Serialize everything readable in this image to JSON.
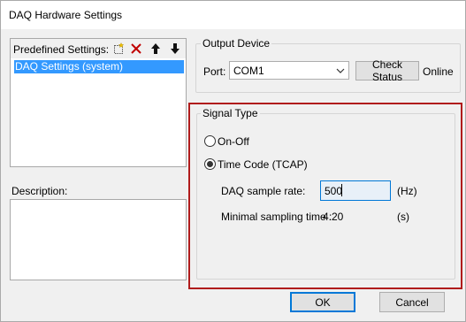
{
  "window": {
    "title": "DAQ Hardware Settings"
  },
  "predefined": {
    "label": "Predefined Settings:",
    "icons": [
      "new-icon",
      "delete-icon",
      "move-up-icon",
      "move-down-icon"
    ],
    "items": [
      "DAQ Settings (system)"
    ]
  },
  "description": {
    "label": "Description:",
    "value": ""
  },
  "output_device": {
    "title": "Output Device",
    "port_label": "Port:",
    "port_value": "COM1",
    "check_status_label": "Check Status",
    "status_text": "Online"
  },
  "signal_type": {
    "title": "Signal Type",
    "options": [
      {
        "label": "On-Off",
        "checked": false
      },
      {
        "label": "Time Code (TCAP)",
        "checked": true
      }
    ],
    "sample_rate_label": "DAQ sample rate:",
    "sample_rate_value": "500",
    "sample_rate_unit": "(Hz)",
    "min_time_label": "Minimal sampling time :",
    "min_time_value": "4.20",
    "min_time_unit": "(s)"
  },
  "footer": {
    "ok_label": "OK",
    "cancel_label": "Cancel"
  },
  "colors": {
    "accent": "#0078d7",
    "selection": "#3399ff",
    "highlight_border": "#b01c1c"
  }
}
